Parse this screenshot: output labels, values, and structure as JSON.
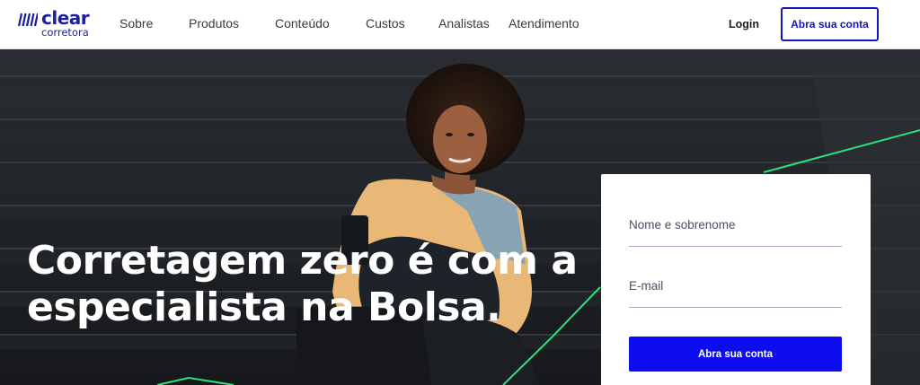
{
  "brand": {
    "logo_main": "clear",
    "logo_sub": "corretora",
    "color": "#1b1f9c"
  },
  "nav": {
    "items": [
      {
        "label": "Sobre"
      },
      {
        "label": "Produtos"
      },
      {
        "label": "Conteúdo"
      },
      {
        "label": "Custos"
      },
      {
        "label": "Analistas"
      },
      {
        "label": "Atendimento"
      }
    ],
    "login_label": "Login",
    "open_account_label": "Abra sua conta"
  },
  "hero": {
    "headline_line1": "Corretagem zero é com a",
    "headline_line2": "especialista na Bolsa.",
    "accent_color": "#2ee07a"
  },
  "form": {
    "name_placeholder": "Nome e sobrenome",
    "email_placeholder": "E-mail",
    "submit_label": "Abra sua conta",
    "submit_color": "#0d0df0"
  }
}
